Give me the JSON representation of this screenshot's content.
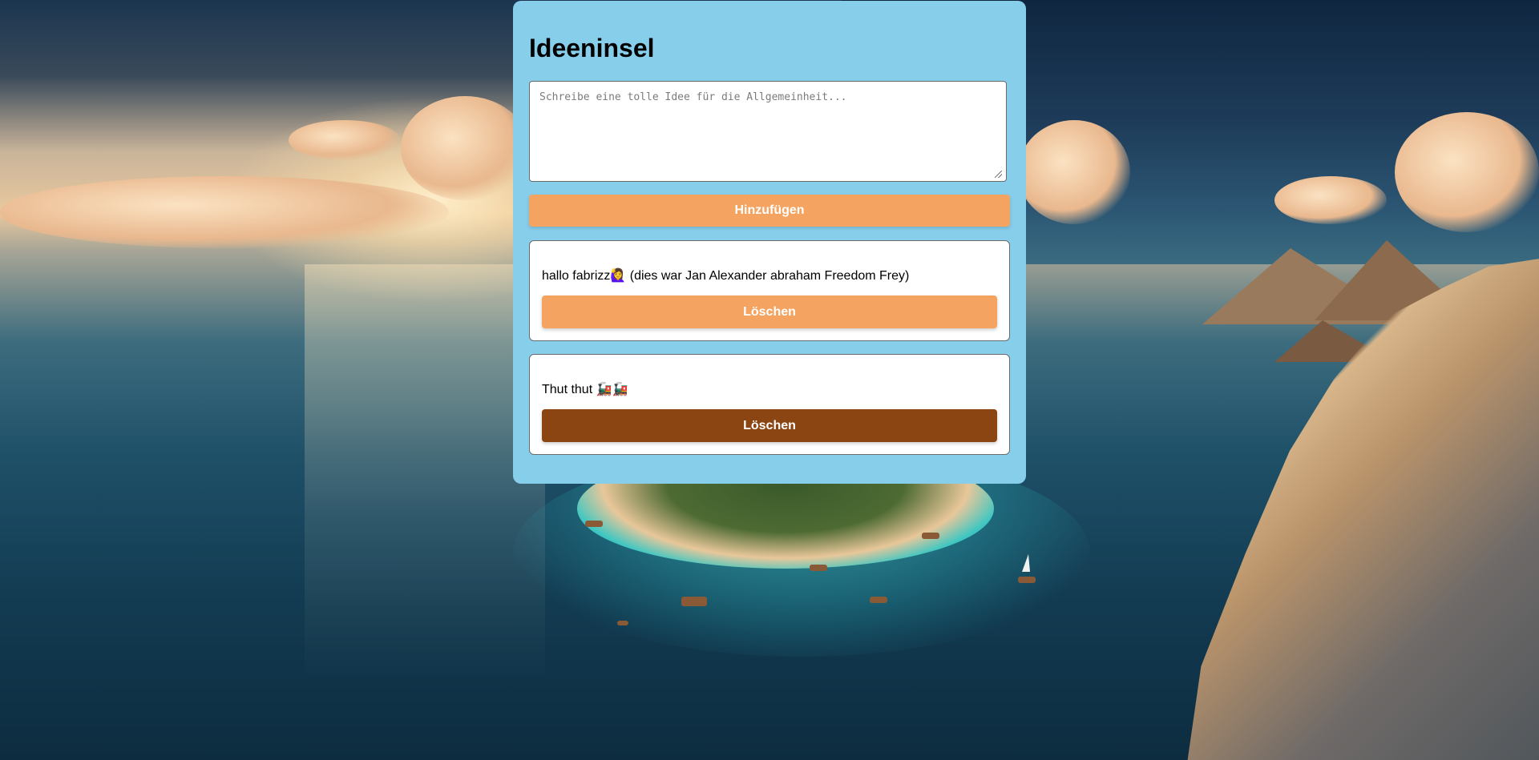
{
  "app": {
    "title": "Ideeninsel"
  },
  "composer": {
    "placeholder": "Schreibe eine tolle Idee für die Allgemeinheit...",
    "value": "",
    "add_label": "Hinzufügen"
  },
  "ideas": [
    {
      "text": "hallo fabrizz🙋‍♀️ (dies war Jan Alexander abraham Freedom Frey)",
      "delete_label": "Löschen",
      "delete_state": "normal"
    },
    {
      "text": "Thut thut 🚂🚂",
      "delete_label": "Löschen",
      "delete_state": "hover"
    }
  ],
  "colors": {
    "panel_bg": "#87ceeb",
    "button_bg": "#f4a460",
    "button_hover_bg": "#8b4513",
    "button_text": "#ffffff"
  },
  "background": {
    "description_icon": "island-landscape-image"
  }
}
